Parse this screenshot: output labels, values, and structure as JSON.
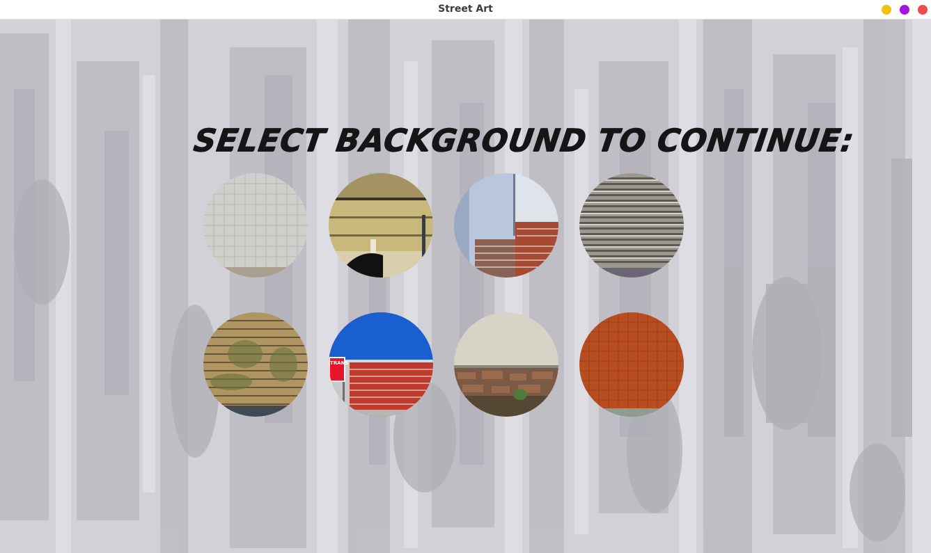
{
  "window": {
    "title": "Street Art",
    "controls": [
      {
        "name": "minimize",
        "color": "#f4c20d"
      },
      {
        "name": "maximize",
        "color": "#a812e0"
      },
      {
        "name": "close",
        "color": "#ec4d4d"
      }
    ]
  },
  "main": {
    "heading": "SELECT BACKGROUND TO CONTINUE:",
    "backgrounds": [
      {
        "label": "white tiled wall"
      },
      {
        "label": "yellow stone wall with drain"
      },
      {
        "label": "blue plaster with bricks"
      },
      {
        "label": "metal roller shutter"
      },
      {
        "label": "yellow brick wall"
      },
      {
        "label": "blue and red brick wall",
        "sign_text": "TRANS"
      },
      {
        "label": "concrete over stone wall"
      },
      {
        "label": "orange tiled wall"
      }
    ]
  },
  "colors": {
    "background": "#d3d1d8",
    "heading": "#151515"
  }
}
